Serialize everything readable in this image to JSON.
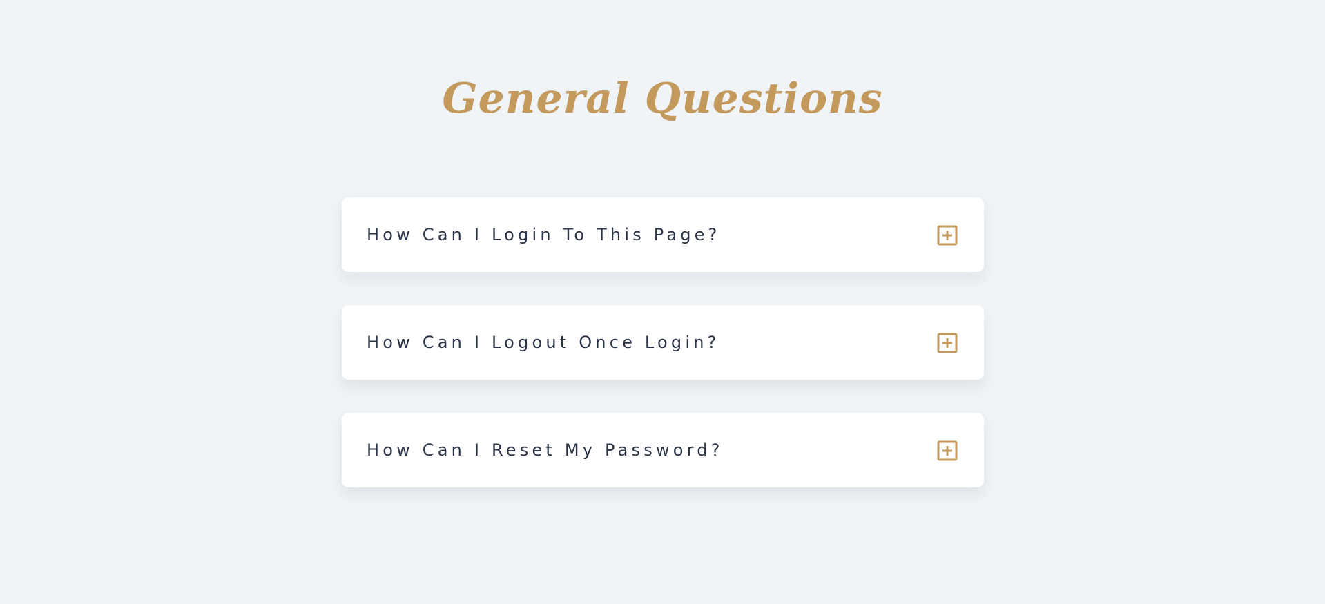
{
  "page": {
    "title": "General Questions"
  },
  "faq": {
    "items": [
      {
        "question": "How Can I Login To This Page?",
        "icon": "plus-square-icon"
      },
      {
        "question": "How Can I Logout Once Login?",
        "icon": "plus-square-icon"
      },
      {
        "question": "How Can I Reset My Password?",
        "icon": "plus-square-icon"
      }
    ]
  },
  "colors": {
    "background": "#f0f4f7",
    "accent": "#c39a5c",
    "card": "#ffffff",
    "question_text": "#2b3447"
  }
}
